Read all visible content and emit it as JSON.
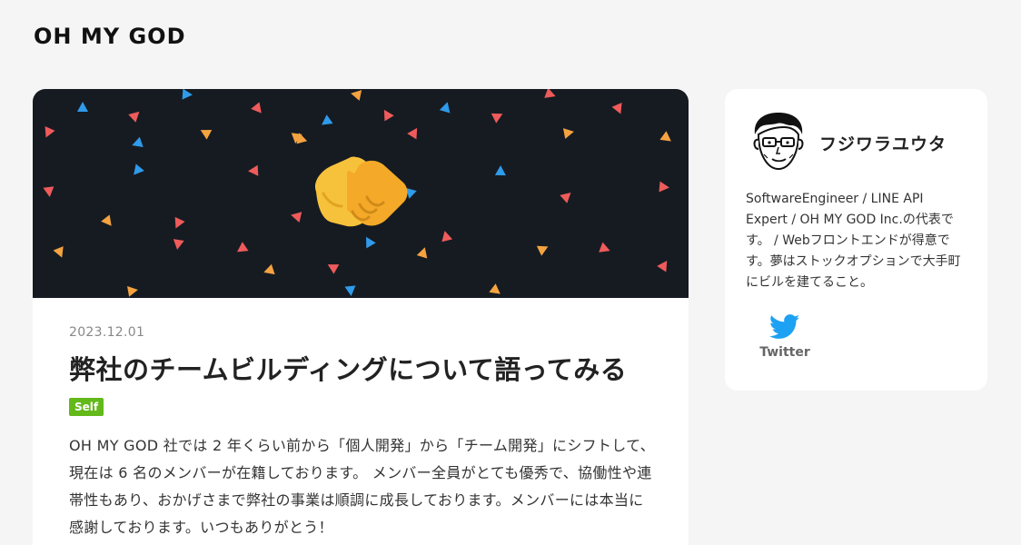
{
  "site": {
    "logo_text": "OH MY GOD"
  },
  "article": {
    "date": "2023.12.01",
    "title": "弊社のチームビルディングについて語ってみる",
    "tag": "Self",
    "excerpt": "OH MY GOD 社では 2 年くらい前から「個人開発」から「チーム開発」にシフトして、現在は 6 名のメンバーが在籍しております。 メンバー全員がとても優秀で、協働性や連帯性もあり、おかげさまで弊社の事業は順調に成長しております。メンバーには本当に感謝しております。いつもありがとう！",
    "hero_icon": "handshake-emoji",
    "hero_palette": [
      "#ef5b5b",
      "#f5a340",
      "#2f9bea"
    ]
  },
  "profile": {
    "name": "フジワラユウタ",
    "bio": "SoftwareEngineer / LINE API Expert / OH MY GOD Inc.の代表です。 / Webフロントエンドが得意です。夢はストックオプションで大手町にビルを建てること。",
    "social": {
      "icon": "twitter-bird-icon",
      "label": "Twitter",
      "color": "#1da1f2"
    }
  }
}
